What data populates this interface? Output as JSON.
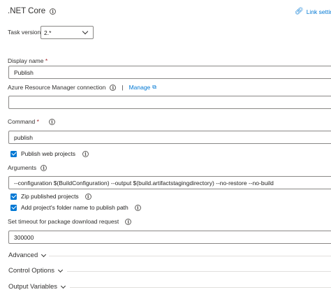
{
  "header": {
    "title": ".NET Core",
    "link_settings": "Link settin"
  },
  "task_version": {
    "label": "Task version",
    "value": "2.*"
  },
  "display_name": {
    "label": "Display name",
    "required_mark": "*",
    "value": "Publish"
  },
  "azure_connection": {
    "label": "Azure Resource Manager connection",
    "separator": "|",
    "manage_label": "Manage",
    "value": ""
  },
  "command": {
    "label": "Command",
    "required_mark": "*",
    "value": "publish"
  },
  "publish_web_projects": {
    "label": "Publish web projects",
    "checked": true
  },
  "arguments": {
    "label": "Arguments",
    "value": "--configuration $(BuildConfiguration) --output $(build.artifactstagingdirectory)  --no-restore --no-build"
  },
  "zip_published": {
    "label": "Zip published projects",
    "checked": true
  },
  "add_folder_name": {
    "label": "Add project's folder name to publish path",
    "checked": true
  },
  "timeout": {
    "label": "Set timeout for package download request",
    "value": "300000"
  },
  "sections": {
    "advanced": "Advanced",
    "control_options": "Control Options",
    "output_variables": "Output Variables"
  },
  "icons": {
    "info": "info-icon",
    "link": "link-icon",
    "external": "external-link-icon",
    "chevron": "chevron-down-icon",
    "checkbox": "checkmark-icon"
  },
  "colors": {
    "accent": "#0078d4",
    "required": "#a4262c",
    "border": "#8a8886"
  }
}
